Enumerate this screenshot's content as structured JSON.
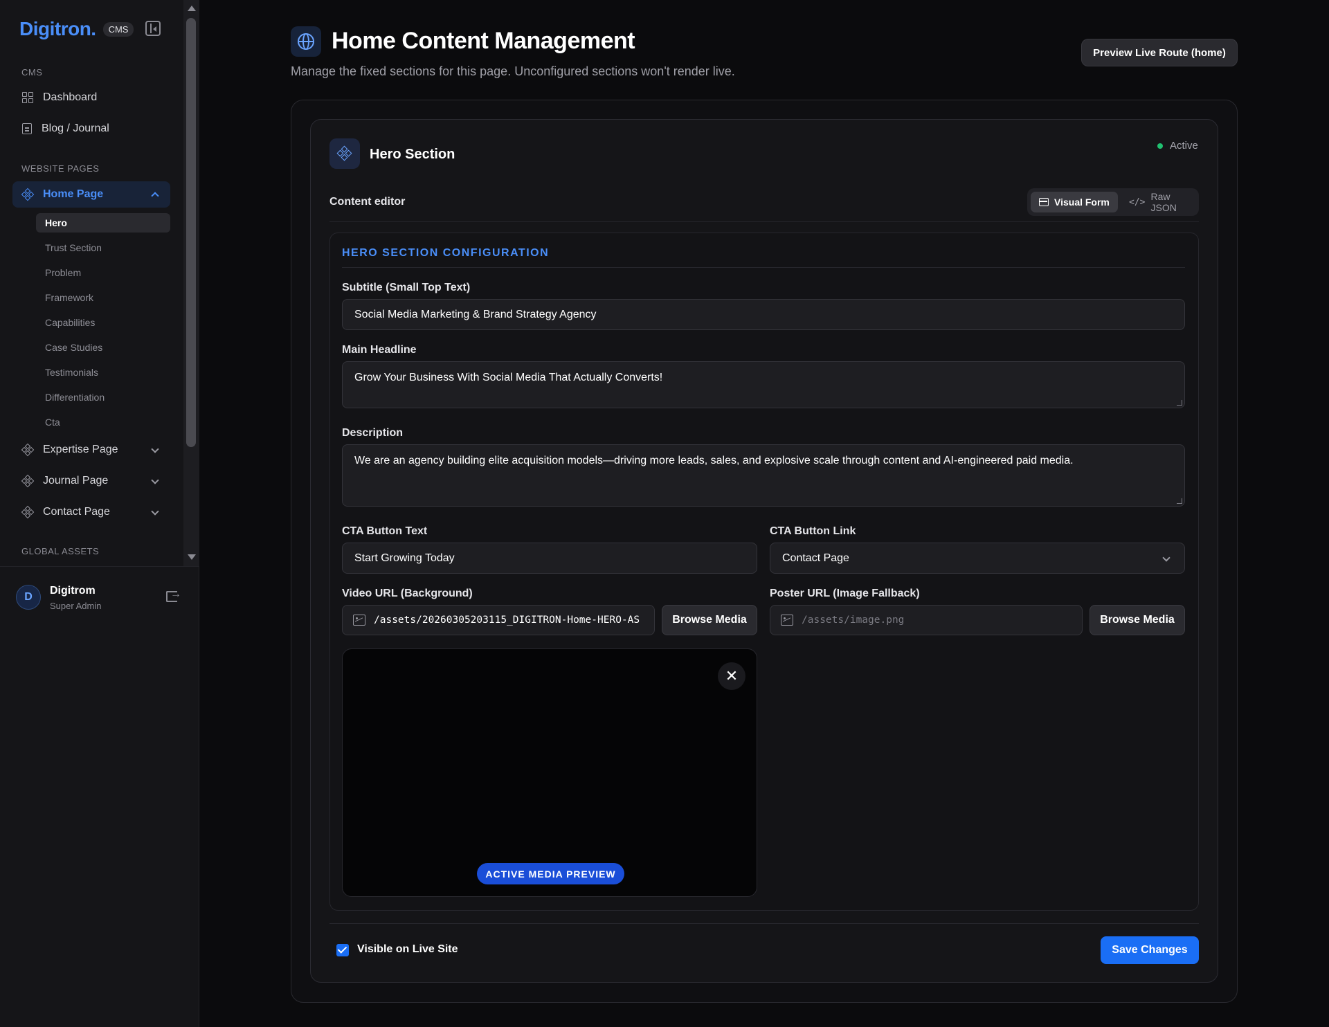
{
  "brand": {
    "name": "Digitron.",
    "badge": "CMS"
  },
  "sidebar": {
    "section_cms": "CMS",
    "items_cms": [
      {
        "label": "Dashboard",
        "icon": "grid-icon"
      },
      {
        "label": "Blog / Journal",
        "icon": "document-icon"
      }
    ],
    "section_pages": "WEBSITE PAGES",
    "pages": [
      {
        "label": "Home Page",
        "icon": "diamond-grid-icon",
        "expanded": true
      },
      {
        "label": "Expertise Page",
        "icon": "diamond-grid-icon"
      },
      {
        "label": "Journal Page",
        "icon": "diamond-grid-icon"
      },
      {
        "label": "Contact Page",
        "icon": "diamond-grid-icon"
      }
    ],
    "home_subitems": [
      "Hero",
      "Trust Section",
      "Problem",
      "Framework",
      "Capabilities",
      "Case Studies",
      "Testimonials",
      "Differentiation",
      "Cta"
    ],
    "section_assets": "GLOBAL ASSETS"
  },
  "user": {
    "initial": "D",
    "name": "Digitrom",
    "role": "Super Admin"
  },
  "header": {
    "title": "Home Content Management",
    "subtitle": "Manage the fixed sections for this page. Unconfigured sections won't render live.",
    "preview_button": "Preview Live Route (home)"
  },
  "section": {
    "title": "Hero Section",
    "status": "Active",
    "status_color": "#20c070",
    "editor_label": "Content editor",
    "mode_visual": "Visual Form",
    "mode_raw": "Raw JSON"
  },
  "config": {
    "title": "HERO SECTION CONFIGURATION",
    "subtitle_label": "Subtitle (Small Top Text)",
    "subtitle_value": "Social Media Marketing & Brand Strategy Agency",
    "headline_label": "Main Headline",
    "headline_value": "Grow Your Business With Social Media That Actually Converts!",
    "description_label": "Description",
    "description_value": "We are an agency building elite acquisition models—driving more leads, sales, and explosive scale through content and AI-engineered paid media.",
    "cta_text_label": "CTA Button Text",
    "cta_text_value": "Start Growing Today",
    "cta_link_label": "CTA Button Link",
    "cta_link_value": "Contact Page",
    "video_label": "Video URL (Background)",
    "video_value": "/assets/20260305203115_DIGITRON-Home-HERO-AS",
    "poster_label": "Poster URL (Image Fallback)",
    "poster_placeholder": "/assets/image.png",
    "browse_label": "Browse Media",
    "preview_badge": "ACTIVE MEDIA PREVIEW"
  },
  "footer": {
    "visible_label": "Visible on Live Site",
    "visible_checked": true,
    "save_label": "Save Changes"
  },
  "colors": {
    "accent": "#4a8ef8",
    "primary_button": "#1a6ef5"
  }
}
